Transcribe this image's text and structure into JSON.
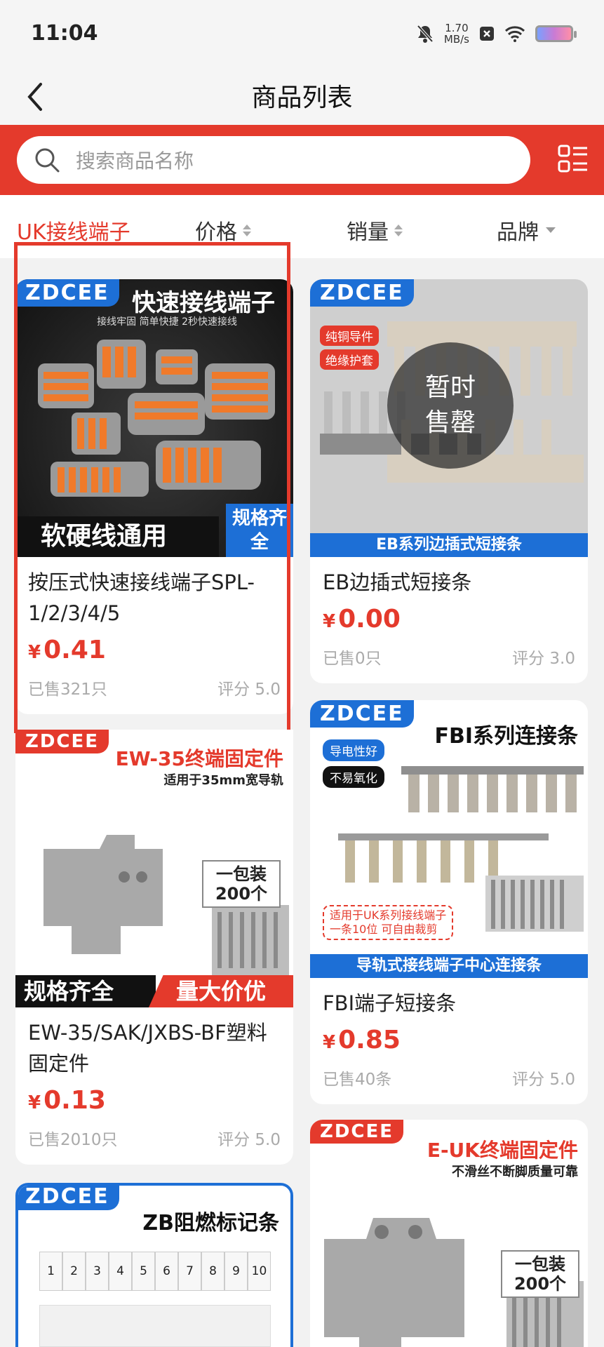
{
  "status": {
    "time": "11:04",
    "speed_value": "1.70",
    "speed_unit": "MB/s"
  },
  "header": {
    "title": "商品列表"
  },
  "search": {
    "placeholder": "搜索商品名称"
  },
  "filters": {
    "category": "UK接线端子",
    "price": "价格",
    "sales": "销量",
    "brand": "品牌"
  },
  "colors": {
    "accent": "#e43a2c",
    "brand_blue": "#1d6fd6"
  },
  "products": [
    {
      "brand": "ZDCEE",
      "image_title": "快速接线端子",
      "image_subtitle": "接线牢固  简单快捷  2秒快速接线",
      "image_banner_left": "软硬线通用",
      "image_banner_right": "规格齐全",
      "name": "按压式快速接线端子SPL-1/2/3/4/5",
      "currency": "¥",
      "price": "0.41",
      "sold": "已售321只",
      "rating": "评分 5.0"
    },
    {
      "brand": "ZDCEE",
      "image_tag1": "纯铜导件",
      "image_tag2": "绝缘护套",
      "image_footer": "EB系列边插式短接条",
      "soldout_line1": "暂时",
      "soldout_line2": "售罄",
      "name": "EB边插式短接条",
      "currency": "¥",
      "price": "0.00",
      "sold": "已售0只",
      "rating": "评分 3.0"
    },
    {
      "brand": "ZDCEE",
      "image_title": "EW-35终端固定件",
      "image_subtitle": "适用于35mm宽导轨",
      "image_pack_line1": "一包装",
      "image_pack_line2": "200个",
      "image_banner_left": "规格齐全",
      "image_banner_right": "量大价优",
      "name": "EW-35/SAK/JXBS-BF塑料固定件",
      "currency": "¥",
      "price": "0.13",
      "sold": "已售2010只",
      "rating": "评分 5.0"
    },
    {
      "brand": "ZDCEE",
      "image_title": "FBI系列连接条",
      "image_tag1": "导电性好",
      "image_tag2": "不易氧化",
      "image_note_line1": "适用于UK系列接线端子",
      "image_note_line2": "一条10位 可自由裁剪",
      "image_footer": "导轨式接线端子中心连接条",
      "name": "FBI端子短接条",
      "currency": "¥",
      "price": "0.85",
      "sold": "已售40条",
      "rating": "评分 5.0"
    },
    {
      "brand": "ZDCEE",
      "image_title": "ZB阻燃标记条",
      "image_numbers": [
        "1",
        "2",
        "3",
        "4",
        "5",
        "6",
        "7",
        "8",
        "9",
        "10"
      ]
    },
    {
      "brand": "ZDCEE",
      "image_title": "E-UK终端固定件",
      "image_subtitle": "不滑丝不断脚质量可靠",
      "image_pack_line1": "一包装",
      "image_pack_line2": "200个"
    }
  ]
}
